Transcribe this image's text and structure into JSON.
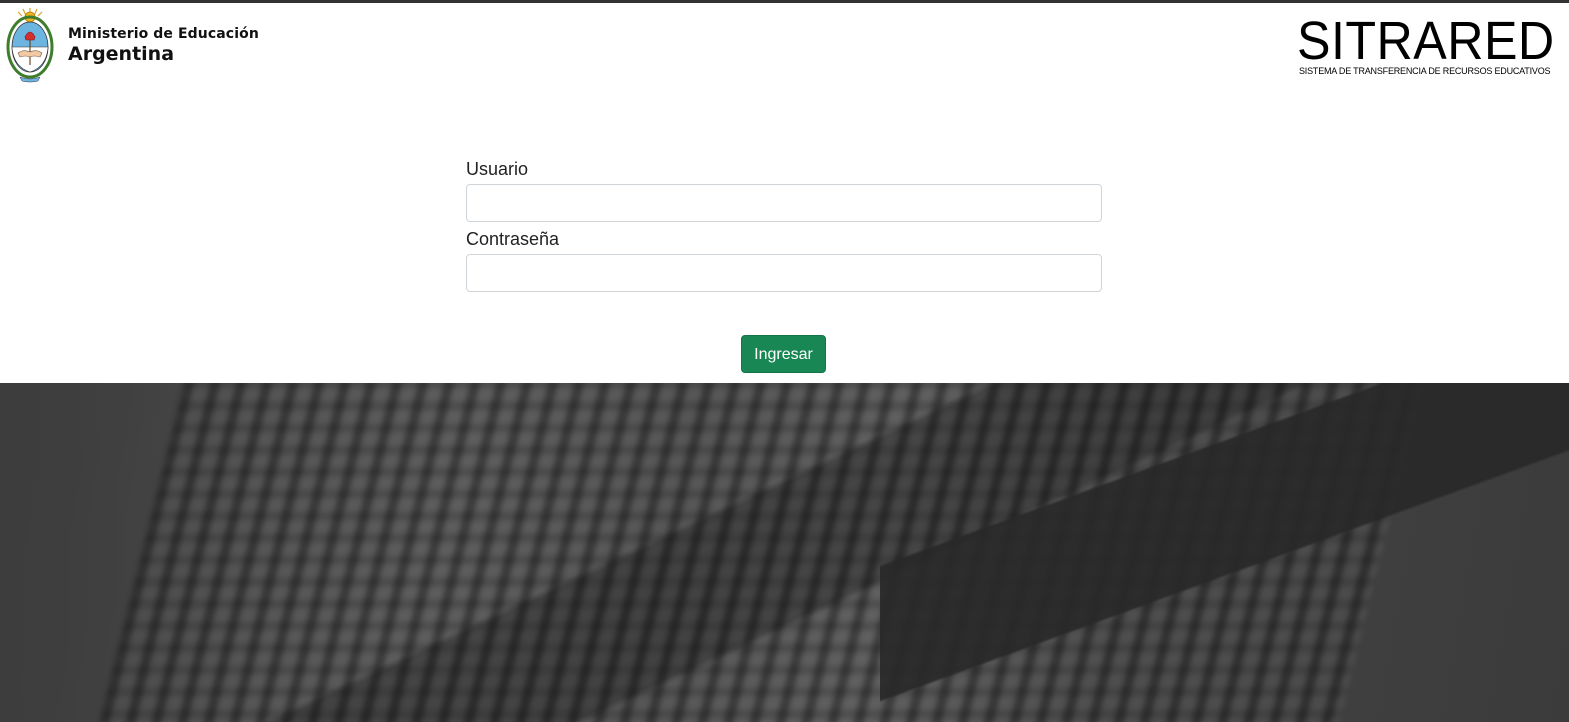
{
  "header": {
    "ministry_line1": "Ministerio de Educación",
    "ministry_line2": "Argentina",
    "app_logo_title": "SITRARED",
    "app_logo_subtitle": "SISTEMA DE TRANSFERENCIA DE RECURSOS EDUCATIVOS",
    "seal_icon": "argentina-coat-of-arms-icon"
  },
  "login": {
    "username_label": "Usuario",
    "username_value": "",
    "password_label": "Contraseña",
    "password_value": "",
    "submit_label": "Ingresar"
  },
  "colors": {
    "primary_button": "#198754",
    "background_dark": "#3a3a3a",
    "panel": "#ffffff"
  }
}
